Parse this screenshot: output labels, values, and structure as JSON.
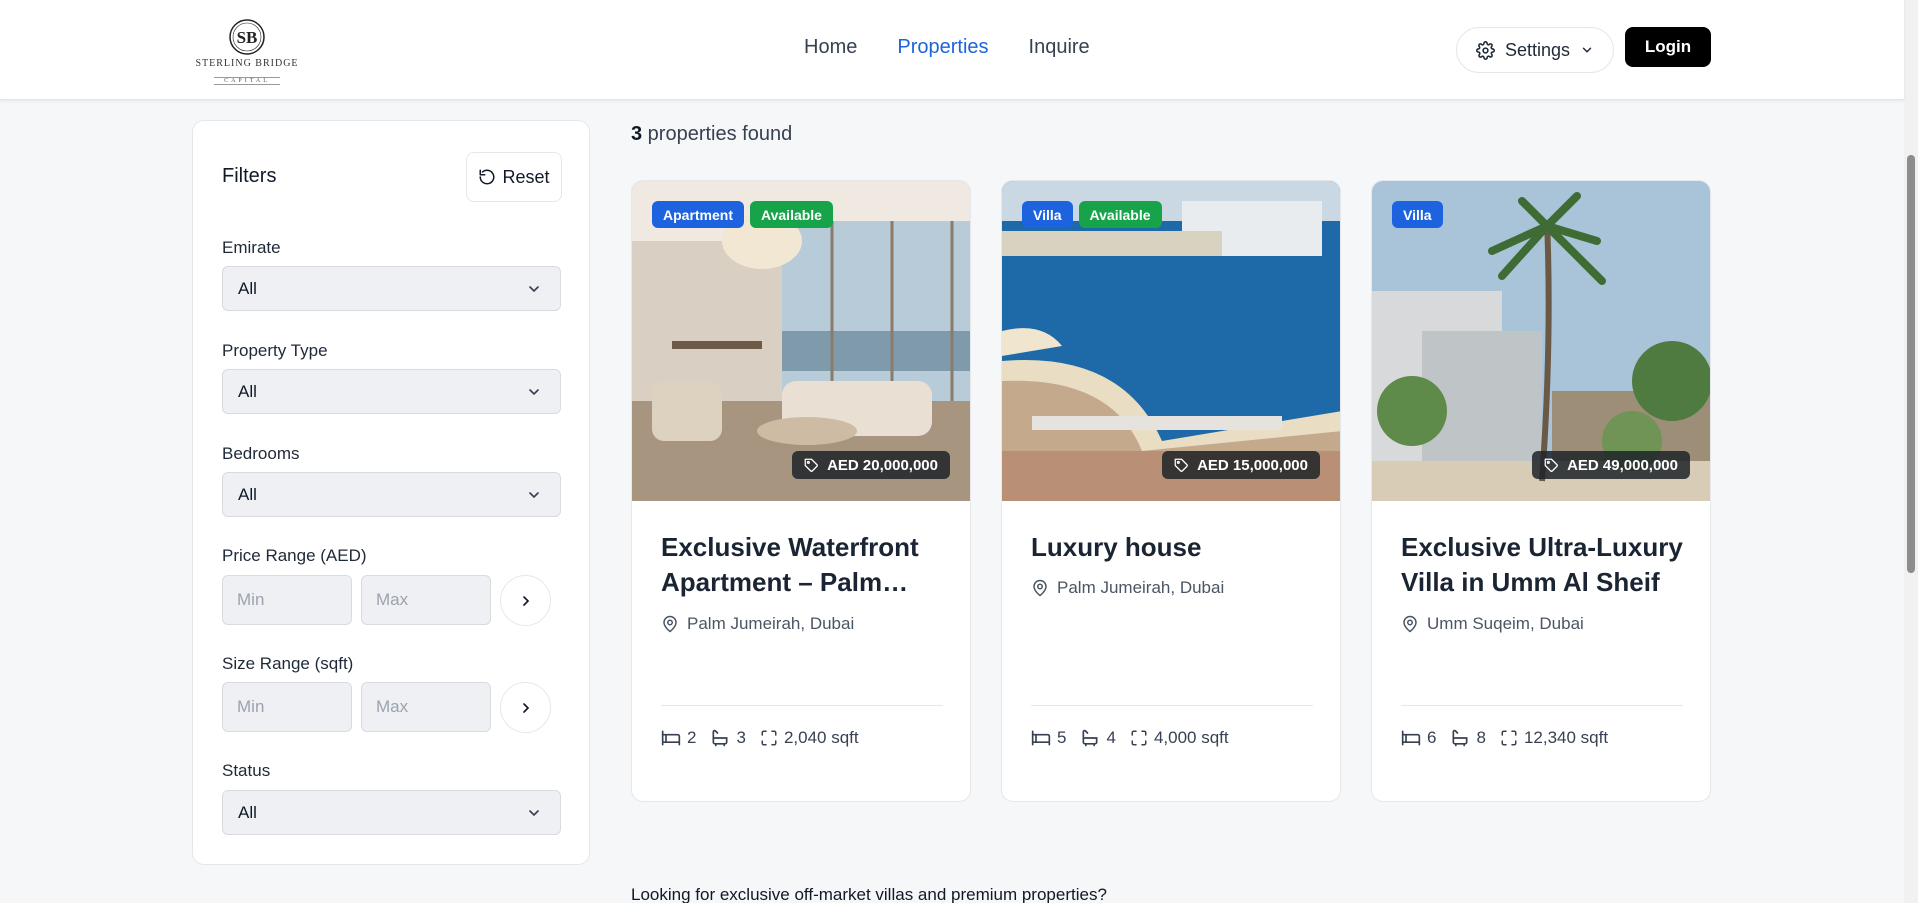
{
  "brand": {
    "logo_name": "STERLING BRIDGE",
    "logo_sub": "CAPITAL",
    "monogram": "SB"
  },
  "nav": {
    "home": "Home",
    "properties": "Properties",
    "inquire": "Inquire",
    "active": "Properties"
  },
  "header": {
    "settings_label": "Settings",
    "login_label": "Login"
  },
  "filters": {
    "title": "Filters",
    "reset_label": "Reset",
    "emirate": {
      "label": "Emirate",
      "value": "All"
    },
    "property_type": {
      "label": "Property Type",
      "value": "All"
    },
    "bedrooms": {
      "label": "Bedrooms",
      "value": "All"
    },
    "price_range": {
      "label": "Price Range (AED)",
      "min_placeholder": "Min",
      "max_placeholder": "Max"
    },
    "size_range": {
      "label": "Size Range (sqft)",
      "min_placeholder": "Min",
      "max_placeholder": "Max"
    },
    "status": {
      "label": "Status",
      "value": "All"
    }
  },
  "results": {
    "count": "3",
    "count_suffix": " properties found",
    "cards": [
      {
        "type": "Apartment",
        "status": "Available",
        "price": "AED 20,000,000",
        "title": "Exclusive Waterfront Apartment – Palm Jumeirah",
        "location": "Palm Jumeirah, Dubai",
        "beds": "2",
        "baths": "3",
        "size": "2,040 sqft"
      },
      {
        "type": "Villa",
        "status": "Available",
        "price": "AED 15,000,000",
        "title": "Luxury house",
        "location": "Palm Jumeirah, Dubai",
        "beds": "5",
        "baths": "4",
        "size": "4,000 sqft"
      },
      {
        "type": "Villa",
        "status": "",
        "price": "AED 49,000,000",
        "title": "Exclusive Ultra-Luxury Villa in Umm Al Sheif",
        "location": "Umm Suqeim, Dubai",
        "beds": "6",
        "baths": "8",
        "size": "12,340 sqft"
      }
    ]
  },
  "footer_prompt": "Looking for exclusive off-market villas and premium properties?",
  "colors": {
    "accent": "#1e64d8",
    "type_badge": "#1d63e0",
    "status_badge": "#16a34a",
    "login_bg": "#000000"
  }
}
